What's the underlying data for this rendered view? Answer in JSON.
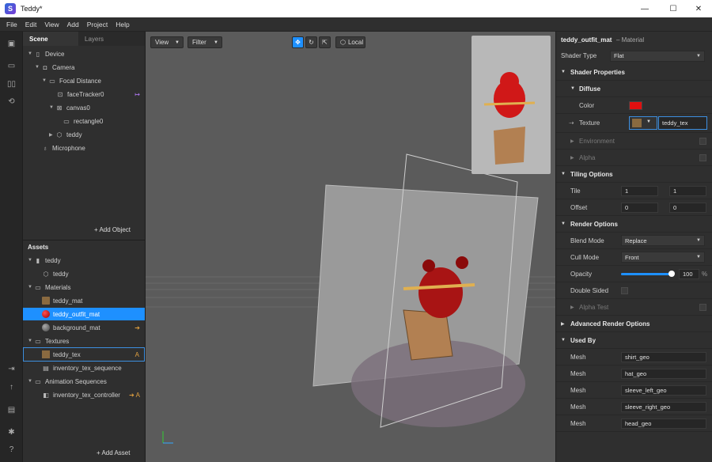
{
  "window": {
    "title": "Teddy*",
    "app_icon": "S"
  },
  "menu": [
    "File",
    "Edit",
    "View",
    "Add",
    "Project",
    "Help"
  ],
  "scene_panel": {
    "tabs": [
      "Scene",
      "Layers"
    ],
    "tree": [
      "Device",
      "Camera",
      "Focal Distance",
      "faceTracker0",
      "canvas0",
      "rectangle0",
      "teddy",
      "Microphone"
    ],
    "add_button": "+ Add Object"
  },
  "assets_panel": {
    "title": "Assets",
    "tree": [
      "teddy",
      "teddy",
      "Materials",
      "teddy_mat",
      "teddy_outfit_mat",
      "background_mat",
      "Textures",
      "teddy_tex",
      "inventory_tex_sequence",
      "Animation Sequences",
      "inventory_tex_controller"
    ],
    "badge": "A",
    "add_button": "+ Add Asset"
  },
  "viewport": {
    "view_label": "View",
    "filter_label": "Filter",
    "local_label": "Local"
  },
  "properties": {
    "title": "teddy_outfit_mat",
    "subtitle": "– Material",
    "shader_type_label": "Shader Type",
    "shader_type_value": "Flat",
    "shader_properties": "Shader Properties",
    "diffuse": "Diffuse",
    "color_label": "Color",
    "color_value": "#e01010",
    "texture_label": "Texture",
    "texture_value": "teddy_tex",
    "environment": "Environment",
    "alpha": "Alpha",
    "tiling_options": "Tiling Options",
    "tile_label": "Tile",
    "tile_x": "1",
    "tile_y": "1",
    "offset_label": "Offset",
    "offset_x": "0",
    "offset_y": "0",
    "render_options": "Render Options",
    "blend_mode_label": "Blend Mode",
    "blend_mode_value": "Replace",
    "cull_mode_label": "Cull Mode",
    "cull_mode_value": "Front",
    "opacity_label": "Opacity",
    "opacity_value": "100",
    "opacity_unit": "%",
    "opacity_fraction": 1.0,
    "double_sided_label": "Double Sided",
    "alpha_test_label": "Alpha Test",
    "advanced_render_options": "Advanced Render Options",
    "used_by": "Used By",
    "mesh_label": "Mesh",
    "meshes": [
      "shirt_geo",
      "hat_geo",
      "sleeve_left_geo",
      "sleeve_right_geo",
      "head_geo"
    ]
  },
  "colors": {
    "accent": "#1e90ff",
    "panel": "#2f2f2f",
    "viewport": "#5b5b5b"
  }
}
